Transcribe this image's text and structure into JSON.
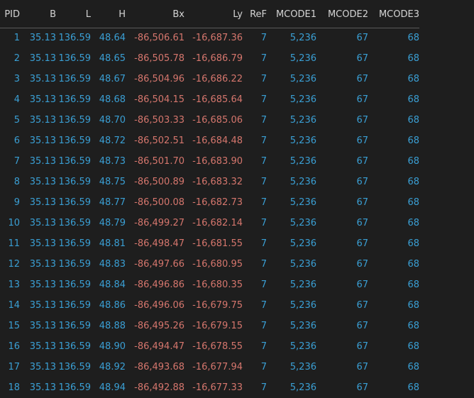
{
  "columns": [
    "PID",
    "B",
    "L",
    "H",
    "Bx",
    "Ly",
    "ReF",
    "MCODE1",
    "MCODE2",
    "MCODE3"
  ],
  "rows": [
    [
      "1",
      "35.13",
      "136.59",
      "48.64",
      "-86,506.61",
      "-16,687.36",
      "7",
      "5,236",
      "67",
      "68"
    ],
    [
      "2",
      "35.13",
      "136.59",
      "48.65",
      "-86,505.78",
      "-16,686.79",
      "7",
      "5,236",
      "67",
      "68"
    ],
    [
      "3",
      "35.13",
      "136.59",
      "48.67",
      "-86,504.96",
      "-16,686.22",
      "7",
      "5,236",
      "67",
      "68"
    ],
    [
      "4",
      "35.13",
      "136.59",
      "48.68",
      "-86,504.15",
      "-16,685.64",
      "7",
      "5,236",
      "67",
      "68"
    ],
    [
      "5",
      "35.13",
      "136.59",
      "48.70",
      "-86,503.33",
      "-16,685.06",
      "7",
      "5,236",
      "67",
      "68"
    ],
    [
      "6",
      "35.13",
      "136.59",
      "48.72",
      "-86,502.51",
      "-16,684.48",
      "7",
      "5,236",
      "67",
      "68"
    ],
    [
      "7",
      "35.13",
      "136.59",
      "48.73",
      "-86,501.70",
      "-16,683.90",
      "7",
      "5,236",
      "67",
      "68"
    ],
    [
      "8",
      "35.13",
      "136.59",
      "48.75",
      "-86,500.89",
      "-16,683.32",
      "7",
      "5,236",
      "67",
      "68"
    ],
    [
      "9",
      "35.13",
      "136.59",
      "48.77",
      "-86,500.08",
      "-16,682.73",
      "7",
      "5,236",
      "67",
      "68"
    ],
    [
      "10",
      "35.13",
      "136.59",
      "48.79",
      "-86,499.27",
      "-16,682.14",
      "7",
      "5,236",
      "67",
      "68"
    ],
    [
      "11",
      "35.13",
      "136.59",
      "48.81",
      "-86,498.47",
      "-16,681.55",
      "7",
      "5,236",
      "67",
      "68"
    ],
    [
      "12",
      "35.13",
      "136.59",
      "48.83",
      "-86,497.66",
      "-16,680.95",
      "7",
      "5,236",
      "67",
      "68"
    ],
    [
      "13",
      "35.13",
      "136.59",
      "48.84",
      "-86,496.86",
      "-16,680.35",
      "7",
      "5,236",
      "67",
      "68"
    ],
    [
      "14",
      "35.13",
      "136.59",
      "48.86",
      "-86,496.06",
      "-16,679.75",
      "7",
      "5,236",
      "67",
      "68"
    ],
    [
      "15",
      "35.13",
      "136.59",
      "48.88",
      "-86,495.26",
      "-16,679.15",
      "7",
      "5,236",
      "67",
      "68"
    ],
    [
      "16",
      "35.13",
      "136.59",
      "48.90",
      "-86,494.47",
      "-16,678.55",
      "7",
      "5,236",
      "67",
      "68"
    ],
    [
      "17",
      "35.13",
      "136.59",
      "48.92",
      "-86,493.68",
      "-16,677.94",
      "7",
      "5,236",
      "67",
      "68"
    ],
    [
      "18",
      "35.13",
      "136.59",
      "48.94",
      "-86,492.88",
      "-16,677.33",
      "7",
      "5,236",
      "67",
      "68"
    ]
  ],
  "colors": {
    "background": "#1e1e1e",
    "header_text": "#d4d4d4",
    "positive_value": "#3a9fd4",
    "negative_value": "#d5766d",
    "header_divider": "#5a5a5a"
  }
}
